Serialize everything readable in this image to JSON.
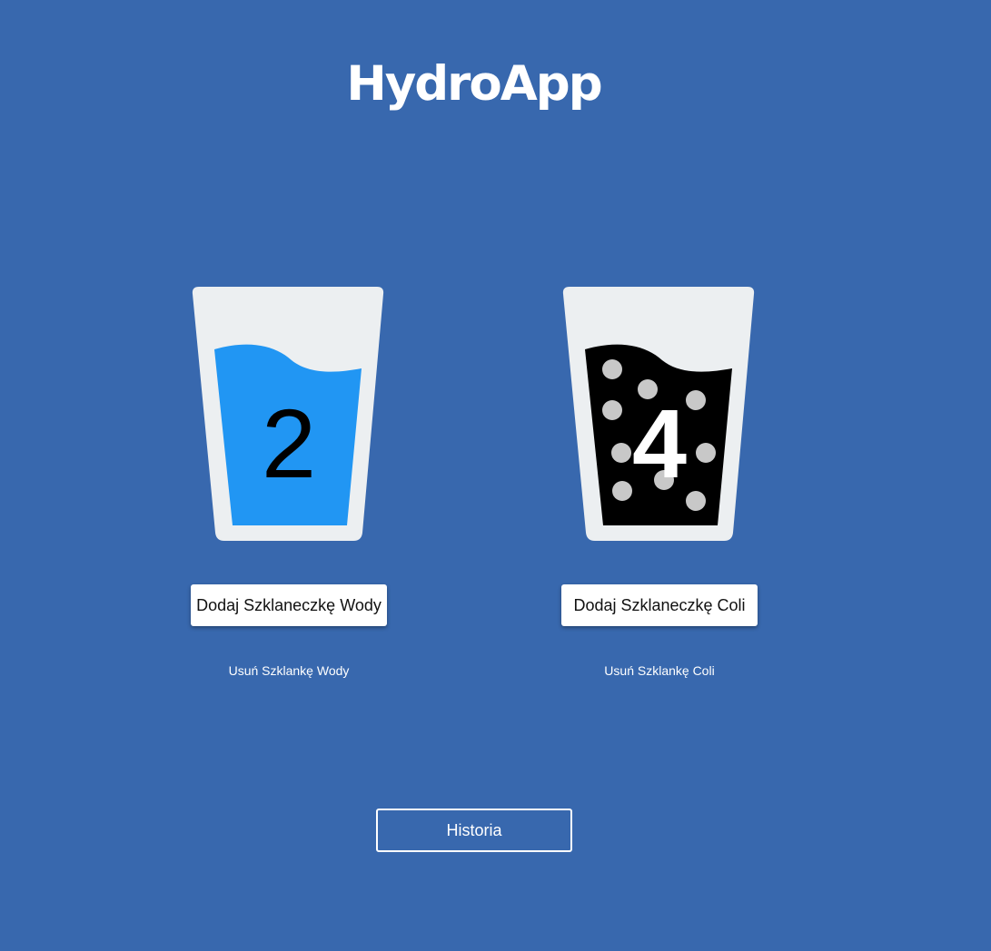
{
  "app": {
    "title": "HydroApp"
  },
  "colors": {
    "background": "#3868ae",
    "glass": "#eceff1",
    "water": "#2196f3",
    "cola": "#000000",
    "bubbles": "#c8c8c8"
  },
  "water": {
    "count": "2",
    "add_label": "Dodaj Szklaneczkę Wody",
    "remove_label": "Usuń Szklankę Wody",
    "icon": "water-glass-icon"
  },
  "cola": {
    "count": "4",
    "add_label": "Dodaj Szklaneczkę Coli",
    "remove_label": "Usuń Szklankę Coli",
    "icon": "cola-glass-icon"
  },
  "history": {
    "label": "Historia"
  }
}
